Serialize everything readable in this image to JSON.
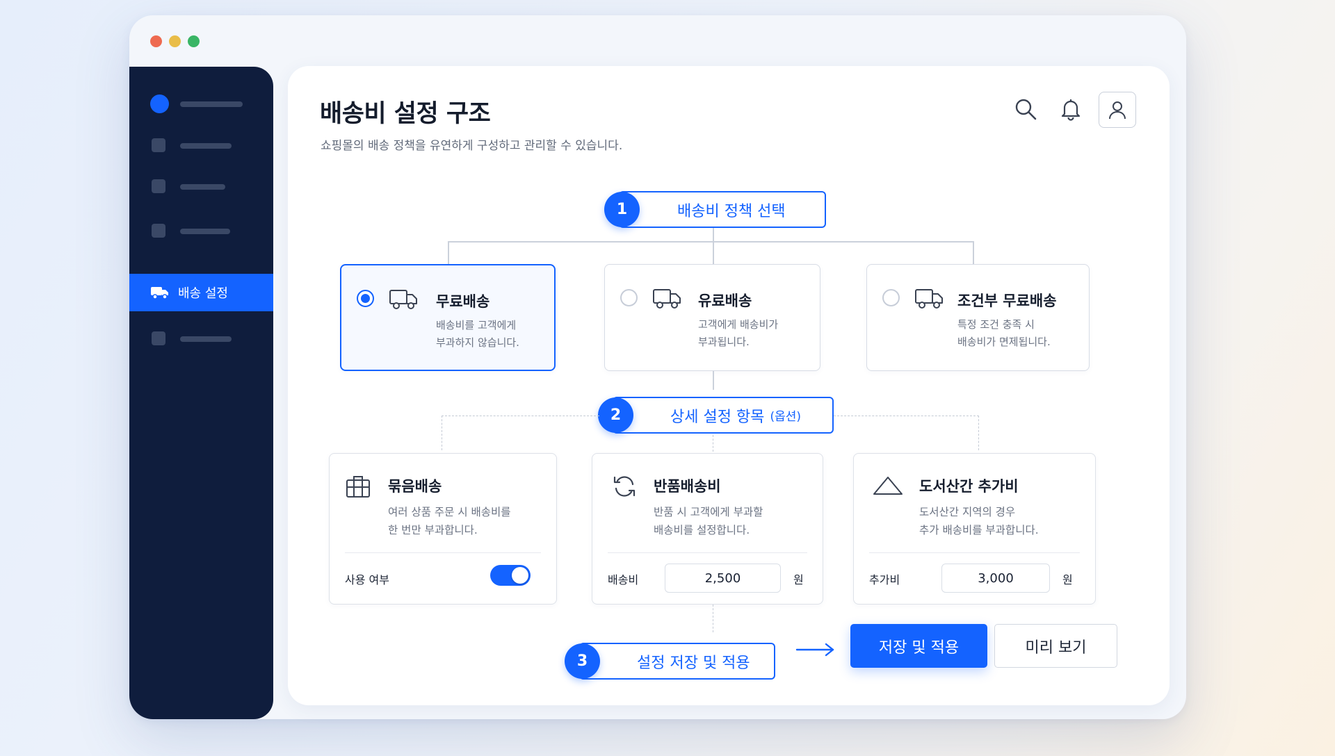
{
  "window": {
    "controls": [
      "close",
      "minimize",
      "maximize"
    ]
  },
  "sidebar": {
    "active_item": {
      "label": "배송 설정",
      "icon": "truck-icon"
    }
  },
  "header": {
    "title": "배송비 설정 구조",
    "subtitle": "쇼핑몰의 배송 정책을 유연하게 구성하고 관리할 수 있습니다.",
    "icons": [
      "search-icon",
      "bell-icon",
      "user-icon"
    ]
  },
  "steps": [
    {
      "number": "1",
      "label": "배송비 정책 선택"
    },
    {
      "number": "2",
      "label": "상세 설정 항목",
      "sub": "(옵션)"
    },
    {
      "number": "3",
      "label": "설정 저장 및 적용"
    }
  ],
  "policies": [
    {
      "title": "무료배송",
      "desc": "배송비를 고객에게\n부과하지 않습니다.",
      "selected": true,
      "icon": "truck-icon"
    },
    {
      "title": "유료배송",
      "desc": "고객에게 배송비가\n부과됩니다.",
      "selected": false,
      "icon": "truck-icon"
    },
    {
      "title": "조건부 무료배송",
      "desc": "특정 조건 충족 시\n배송비가 면제됩니다.",
      "selected": false,
      "icon": "truck-icon"
    }
  ],
  "details": [
    {
      "title": "묶음배송",
      "desc": "여러 상품 주문 시 배송비를\n한 번만 부과합니다.",
      "label": "사용 여부",
      "toggle_on": true,
      "icon": "package-icon"
    },
    {
      "title": "반품배송비",
      "desc": "반품 시 고객에게 부과할\n배송비를 설정합니다.",
      "label": "배송비",
      "value": "2,500",
      "unit": "원",
      "icon": "refresh-icon"
    },
    {
      "title": "도서산간 추가비",
      "desc": "도서산간 지역의 경우\n추가 배송비를 부과합니다.",
      "label": "추가비",
      "value": "3,000",
      "unit": "원",
      "icon": "mountain-icon"
    }
  ],
  "actions": {
    "save_apply": "저장 및 적용",
    "preview": "미리 보기"
  },
  "colors": {
    "accent": "#1463ff",
    "sidebar": "#0f1d3d"
  }
}
